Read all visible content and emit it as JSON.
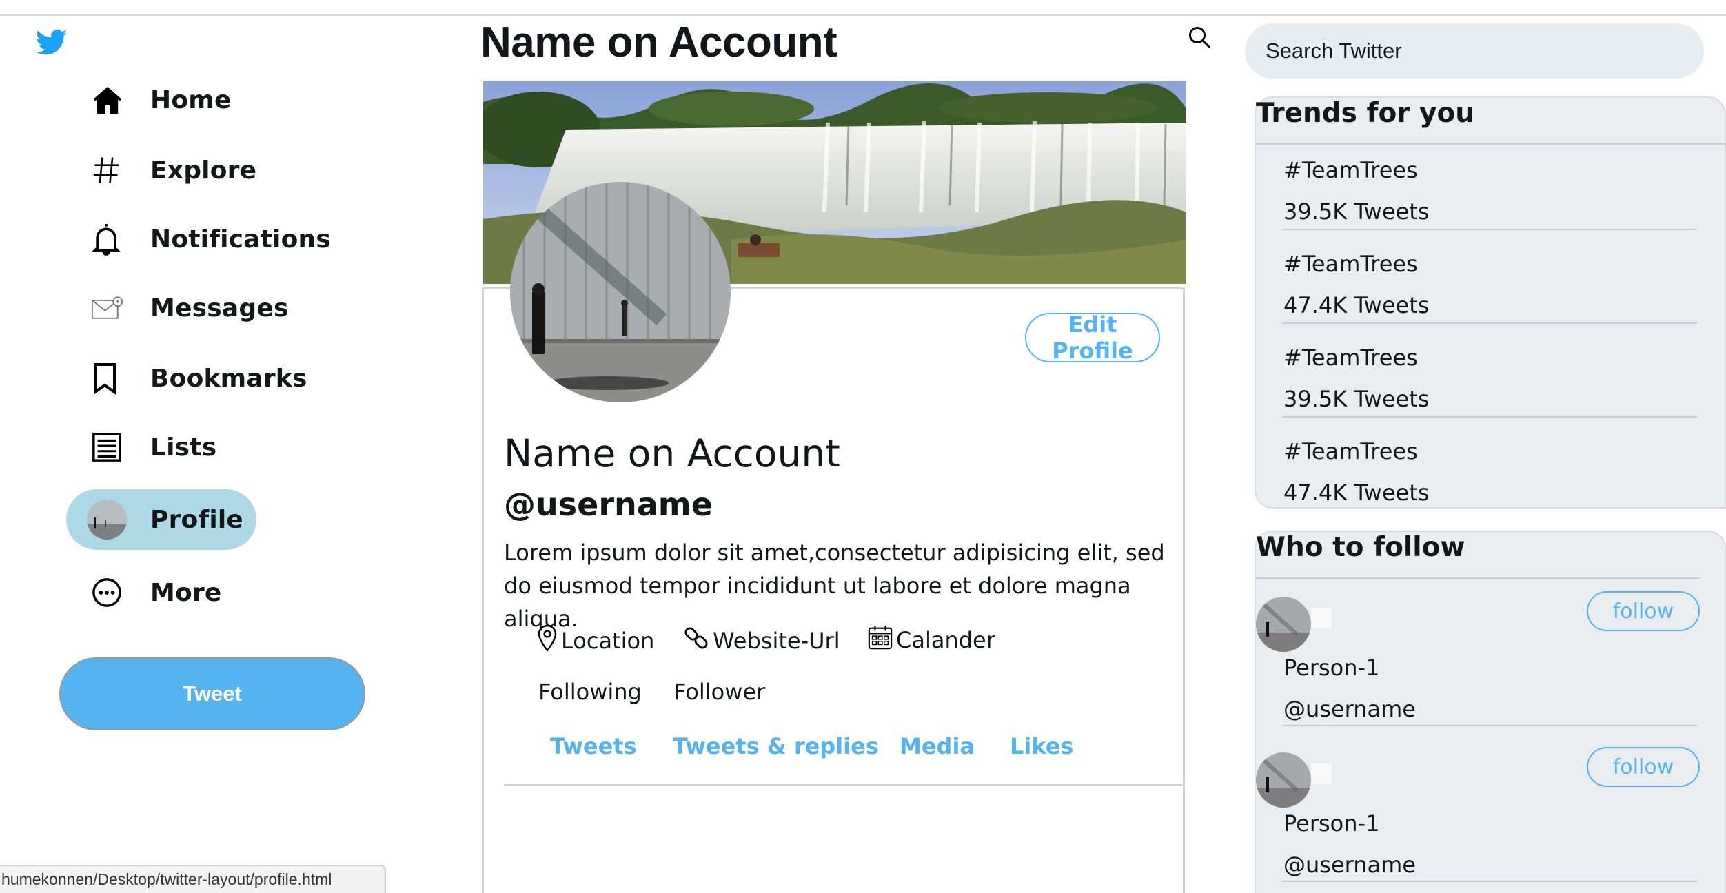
{
  "sidebar": {
    "items": [
      {
        "label": "Home",
        "icon": "home-icon"
      },
      {
        "label": "Explore",
        "icon": "hashtag-icon"
      },
      {
        "label": "Notifications",
        "icon": "bell-icon"
      },
      {
        "label": "Messages",
        "icon": "envelope-icon"
      },
      {
        "label": "Bookmarks",
        "icon": "bookmark-icon"
      },
      {
        "label": "Lists",
        "icon": "list-icon"
      },
      {
        "label": "Profile",
        "icon": "avatar"
      },
      {
        "label": "More",
        "icon": "more-icon"
      }
    ],
    "active_item": "Profile",
    "tweet_label": "Tweet"
  },
  "header": {
    "title": "Name on Account"
  },
  "profile": {
    "edit_label": "Edit Profile",
    "name": "Name on Account",
    "handle": "@username",
    "bio": "Lorem ipsum dolor sit amet,consectetur adipisicing elit, sed do eiusmod tempor incididunt ut labore et dolore magna aliqua.",
    "location": "Location",
    "website": "Website-Url",
    "calendar": "Calander",
    "following": "Following",
    "follower": "Follower",
    "tabs": [
      "Tweets",
      "Tweets & replies",
      "Media",
      "Likes"
    ]
  },
  "search": {
    "placeholder": "Search Twitter"
  },
  "trends": {
    "title": "Trends for you",
    "items": [
      {
        "tag": "#TeamTrees",
        "count": "39.5K Tweets"
      },
      {
        "tag": "#TeamTrees",
        "count": "47.4K Tweets"
      },
      {
        "tag": "#TeamTrees",
        "count": "39.5K Tweets"
      },
      {
        "tag": "#TeamTrees",
        "count": "47.4K Tweets"
      }
    ]
  },
  "who_to_follow": {
    "title": "Who to follow",
    "people": [
      {
        "name": "Person-1",
        "handle": "@username",
        "button": "follow"
      },
      {
        "name": "Person-1",
        "handle": "@username",
        "button": "follow"
      }
    ]
  },
  "statusbar": {
    "url": "humekonnen/Desktop/twitter-layout/profile.html"
  },
  "colors": {
    "accent": "#55b4ef",
    "active_nav": "#add8e6",
    "panel_bg": "#e9edf0",
    "search_bg": "#e6ecf0"
  }
}
